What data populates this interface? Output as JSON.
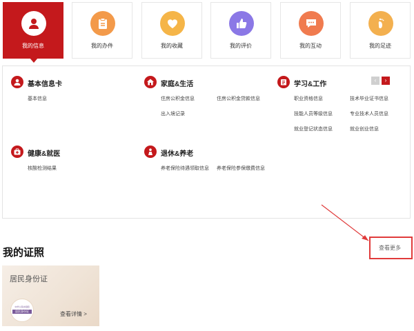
{
  "tabs": [
    {
      "label": "我的信息",
      "icon": "user-icon",
      "color": "#c4191c",
      "active": true
    },
    {
      "label": "我的办件",
      "icon": "clipboard-icon",
      "color": "#f39a4a",
      "active": false
    },
    {
      "label": "我的收藏",
      "icon": "heart-icon",
      "color": "#f5b548",
      "active": false
    },
    {
      "label": "我的评价",
      "icon": "thumbs-up-icon",
      "color": "#8b78e6",
      "active": false
    },
    {
      "label": "我的互动",
      "icon": "chat-icon",
      "color": "#f07b4f",
      "active": false
    },
    {
      "label": "我的足迹",
      "icon": "footprint-icon",
      "color": "#f3b04f",
      "active": false
    }
  ],
  "categories": {
    "basic": {
      "title": "基本信息卡",
      "icon": "person-icon",
      "items": [
        "基本信息"
      ]
    },
    "family": {
      "title": "家庭&生活",
      "icon": "house-icon",
      "items": [
        "住房公积金信息",
        "住房公积金贷款信息",
        "出入境记录"
      ]
    },
    "study": {
      "title": "学习&工作",
      "icon": "book-icon",
      "items": [
        "职业资格信息",
        "技术毕业证书信息",
        "技能人员等级信息",
        "专业技术人员信息",
        "就业登记状态信息",
        "就业创业信息"
      ]
    },
    "health": {
      "title": "健康&就医",
      "icon": "medical-bag-icon",
      "items": [
        "核酸检测结果"
      ]
    },
    "retire": {
      "title": "退休&养老",
      "icon": "elder-icon",
      "items": [
        "养老保险待遇领取信息",
        "养老保险参保缴费信息"
      ]
    }
  },
  "pager": {
    "prev": "‹",
    "next": "›"
  },
  "certificates": {
    "section_title": "我的证照",
    "more_label": "查看更多",
    "card": {
      "title": "居民身份证",
      "detail_label": "查看详情 >",
      "seal_line1": "中华人民共和国",
      "seal_line2": "居民身份证"
    }
  },
  "colors": {
    "brand": "#c4191c",
    "annotation": "#e03a3a"
  }
}
